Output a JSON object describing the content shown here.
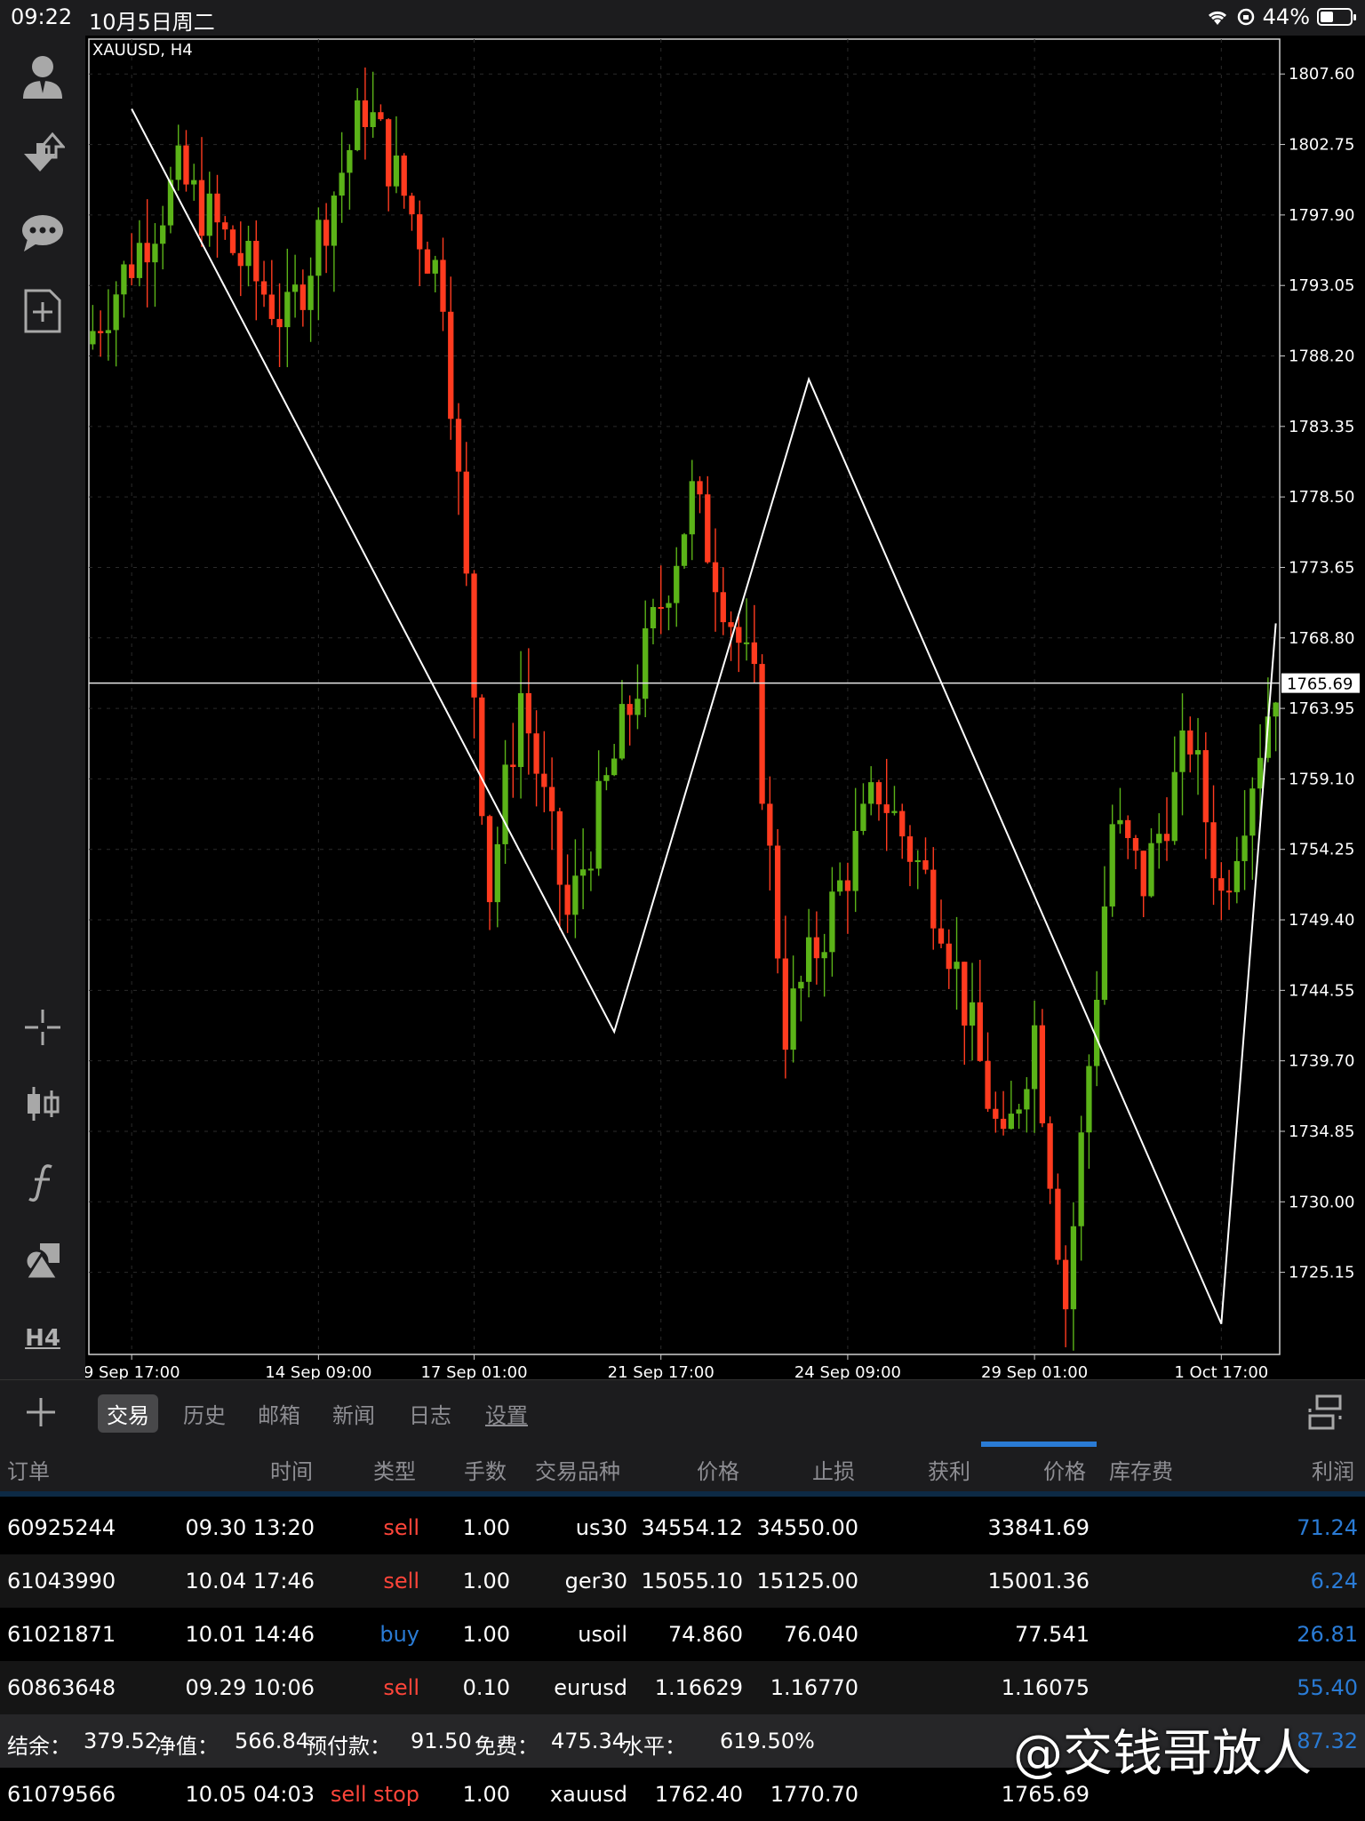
{
  "status_bar": {
    "time": "09:22",
    "date": "10月5日周二",
    "battery": "44%"
  },
  "chart": {
    "title": "XAUUSD, H4",
    "current_price": "1765.69"
  },
  "chart_data": {
    "type": "candlestick",
    "symbol": "XAUUSD",
    "timeframe": "H4",
    "y_ticks": [
      "1807.60",
      "1802.75",
      "1797.90",
      "1793.05",
      "1788.20",
      "1783.35",
      "1778.50",
      "1773.65",
      "1768.80",
      "1763.95",
      "1759.10",
      "1754.25",
      "1749.40",
      "1744.55",
      "1739.70",
      "1734.85",
      "1730.00",
      "1725.15"
    ],
    "ylim": [
      1719.5,
      1810.0
    ],
    "x_tick_labels": [
      "9 Sep 17:00",
      "14 Sep 09:00",
      "17 Sep 01:00",
      "21 Sep 17:00",
      "24 Sep 09:00",
      "29 Sep 01:00",
      "1 Oct 17:00"
    ],
    "x_tick_candle_index": [
      5,
      29,
      49,
      73,
      97,
      121,
      145
    ],
    "candle_count": 153,
    "current_price": 1765.69,
    "zigzag_prices": [
      1805.2,
      1741.7,
      1786.6,
      1721.6,
      1769.8
    ],
    "zigzag_candle_index": [
      5,
      67,
      92,
      145,
      152
    ],
    "series": [
      {
        "segment_start": 1789.0,
        "segment_end": 1800.5,
        "from": 0,
        "to": 12
      },
      {
        "segment_start": 1800.5,
        "segment_end": 1790.5,
        "from": 12,
        "to": 26
      },
      {
        "segment_start": 1790.5,
        "segment_end": 1805.5,
        "from": 26,
        "to": 36
      },
      {
        "segment_start": 1805.5,
        "segment_end": 1793.0,
        "from": 36,
        "to": 46
      },
      {
        "segment_start": 1793.0,
        "segment_end": 1751.5,
        "from": 46,
        "to": 52
      },
      {
        "segment_start": 1751.5,
        "segment_end": 1765.0,
        "from": 52,
        "to": 56
      },
      {
        "segment_start": 1765.0,
        "segment_end": 1749.5,
        "from": 56,
        "to": 62
      },
      {
        "segment_start": 1749.5,
        "segment_end": 1764.0,
        "from": 62,
        "to": 70
      },
      {
        "segment_start": 1764.0,
        "segment_end": 1778.5,
        "from": 70,
        "to": 78
      },
      {
        "segment_start": 1778.5,
        "segment_end": 1772.0,
        "from": 78,
        "to": 82
      },
      {
        "segment_start": 1772.0,
        "segment_end": 1765.0,
        "from": 82,
        "to": 86
      },
      {
        "segment_start": 1765.0,
        "segment_end": 1742.0,
        "from": 86,
        "to": 90
      },
      {
        "segment_start": 1742.0,
        "segment_end": 1758.5,
        "from": 90,
        "to": 102
      },
      {
        "segment_start": 1758.5,
        "segment_end": 1750.0,
        "from": 102,
        "to": 110
      },
      {
        "segment_start": 1750.0,
        "segment_end": 1733.0,
        "from": 110,
        "to": 118
      },
      {
        "segment_start": 1733.0,
        "segment_end": 1742.0,
        "from": 118,
        "to": 122
      },
      {
        "segment_start": 1742.0,
        "segment_end": 1723.0,
        "from": 122,
        "to": 126
      },
      {
        "segment_start": 1723.0,
        "segment_end": 1756.0,
        "from": 126,
        "to": 132
      },
      {
        "segment_start": 1756.0,
        "segment_end": 1752.0,
        "from": 132,
        "to": 136
      },
      {
        "segment_start": 1752.0,
        "segment_end": 1762.0,
        "from": 136,
        "to": 142
      },
      {
        "segment_start": 1762.0,
        "segment_end": 1751.0,
        "from": 142,
        "to": 146
      },
      {
        "segment_start": 1751.0,
        "segment_end": 1766.0,
        "from": 146,
        "to": 153
      }
    ]
  },
  "tabs": [
    "交易",
    "历史",
    "邮箱",
    "新闻",
    "日志",
    "设置"
  ],
  "table": {
    "headers": [
      "订单",
      "时间",
      "类型",
      "手数",
      "交易品种",
      "价格",
      "止损",
      "获利",
      "价格",
      "库存费",
      "利润"
    ],
    "rows": [
      {
        "order": "60925244",
        "time": "09.30 13:20",
        "type": "sell",
        "lots": "1.00",
        "symbol": "us30",
        "price": "34554.12",
        "sl": "34550.00",
        "tp": "",
        "cur": "33841.69",
        "swap": "",
        "profit": "71.24"
      },
      {
        "order": "61043990",
        "time": "10.04 17:46",
        "type": "sell",
        "lots": "1.00",
        "symbol": "ger30",
        "price": "15055.10",
        "sl": "15125.00",
        "tp": "",
        "cur": "15001.36",
        "swap": "",
        "profit": "6.24"
      },
      {
        "order": "61021871",
        "time": "10.01 14:46",
        "type": "buy",
        "lots": "1.00",
        "symbol": "usoil",
        "price": "74.860",
        "sl": "76.040",
        "tp": "",
        "cur": "77.541",
        "swap": "",
        "profit": "26.81"
      },
      {
        "order": "60863648",
        "time": "09.29 10:06",
        "type": "sell",
        "lots": "0.10",
        "symbol": "eurusd",
        "price": "1.16629",
        "sl": "1.16770",
        "tp": "",
        "cur": "1.16075",
        "swap": "",
        "profit": "55.40"
      }
    ],
    "summary": {
      "balance_label": "结余：",
      "balance": "379.52",
      "equity_label": "净值：",
      "equity": "566.84",
      "margin_label": "预付款：",
      "margin": "91.50",
      "free_label": "免费：",
      "free": "475.34",
      "level_label": "水平：",
      "level": "619.50%",
      "profit_partial": "87.32"
    },
    "pending": {
      "order": "61079566",
      "time": "10.05 04:03",
      "type": "sell stop",
      "lots": "1.00",
      "symbol": "xauusd",
      "price": "1762.40",
      "sl": "1770.70",
      "tp": "",
      "cur": "1765.69"
    }
  },
  "watermark": "@交钱哥放人",
  "colors": {
    "bull": "#5bb318",
    "bear": "#ff3b1f",
    "accent": "#2a7bd5",
    "sell": "#ff453a"
  }
}
